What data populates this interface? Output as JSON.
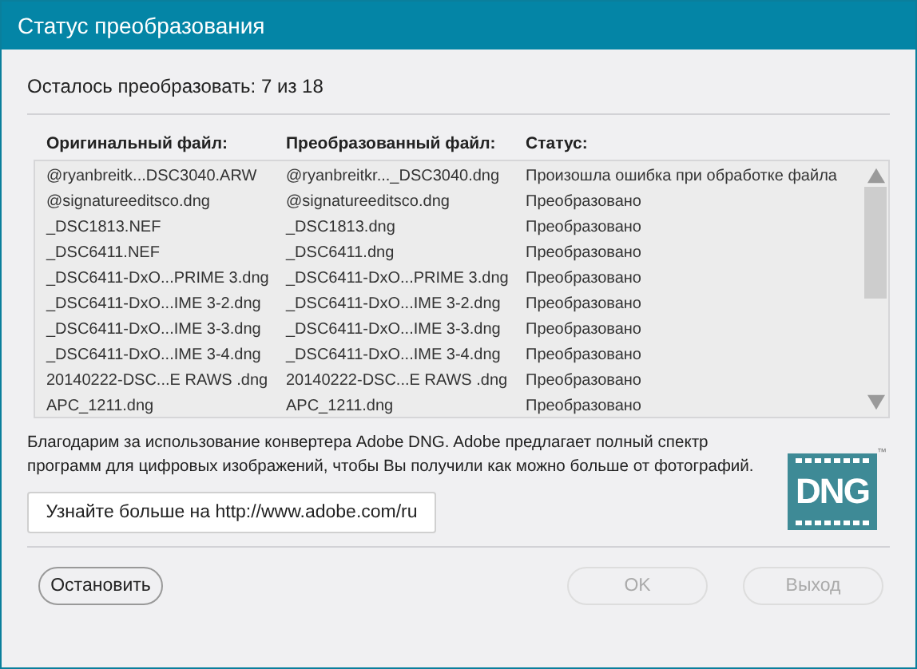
{
  "window": {
    "title": "Статус преобразования"
  },
  "progress": "Осталось преобразовать: 7 из 18",
  "table": {
    "columns": [
      "Оригинальный файл:",
      "Преобразованный файл:",
      "Статус:"
    ],
    "rows": [
      {
        "original": "@ryanbreitk...DSC3040.ARW",
        "converted": "@ryanbreitkr..._DSC3040.dng",
        "status": "Произошла ошибка при обработке файла"
      },
      {
        "original": "@signatureeditsco.dng",
        "converted": "@signatureeditsco.dng",
        "status": "Преобразовано"
      },
      {
        "original": "_DSC1813.NEF",
        "converted": "_DSC1813.dng",
        "status": "Преобразовано"
      },
      {
        "original": "_DSC6411.NEF",
        "converted": "_DSC6411.dng",
        "status": "Преобразовано"
      },
      {
        "original": "_DSC6411-DxO...PRIME 3.dng",
        "converted": "_DSC6411-DxO...PRIME 3.dng",
        "status": "Преобразовано"
      },
      {
        "original": "_DSC6411-DxO...IME 3-2.dng",
        "converted": "_DSC6411-DxO...IME 3-2.dng",
        "status": "Преобразовано"
      },
      {
        "original": "_DSC6411-DxO...IME 3-3.dng",
        "converted": "_DSC6411-DxO...IME 3-3.dng",
        "status": "Преобразовано"
      },
      {
        "original": "_DSC6411-DxO...IME 3-4.dng",
        "converted": "_DSC6411-DxO...IME 3-4.dng",
        "status": "Преобразовано"
      },
      {
        "original": "20140222-DSC...E RAWS .dng",
        "converted": "20140222-DSC...E RAWS .dng",
        "status": "Преобразовано"
      },
      {
        "original": "APC_1211.dng",
        "converted": "APC_1211.dng",
        "status": "Преобразовано"
      }
    ]
  },
  "message": "Благодарим за использование конвертера Adobe DNG.  Adobe предлагает полный спектр программ для цифровых изображений, чтобы Вы получили как можно больше от фотографий.",
  "logo": {
    "text": "DNG",
    "mark": "™"
  },
  "learn_more_button": {
    "label": "Узнайте больше на http://www.adobe.com/ru"
  },
  "buttons": [
    {
      "label": "Остановить",
      "disabled": false
    },
    {
      "label": "OK",
      "disabled": true
    },
    {
      "label": "Выход",
      "disabled": true
    }
  ]
}
